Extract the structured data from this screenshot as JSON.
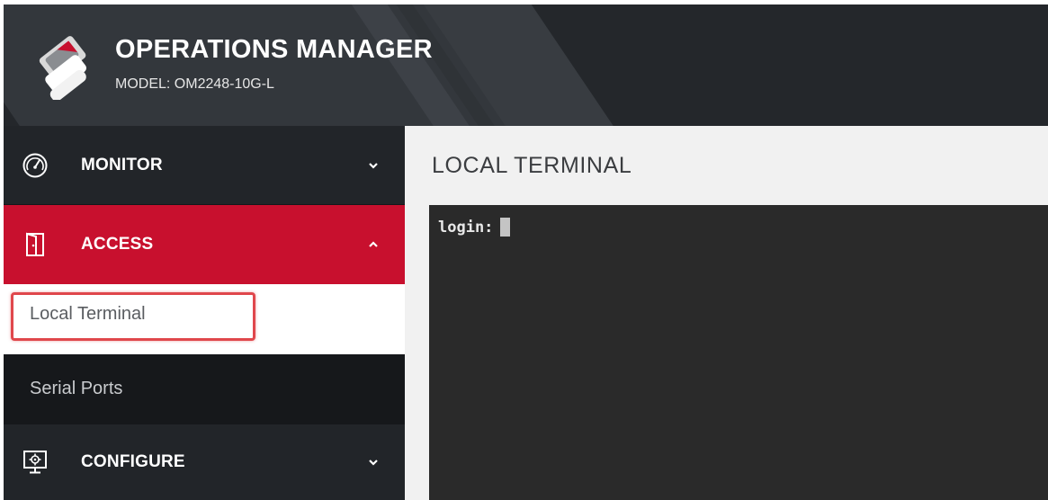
{
  "header": {
    "title": "OPERATIONS MANAGER",
    "model": "MODEL: OM2248-10G-L",
    "logo_icon": "opengear-logo-icon"
  },
  "sidebar": {
    "items": [
      {
        "label": "MONITOR",
        "icon": "speedometer-icon",
        "chevron": "chevron-down-icon",
        "expanded": false
      },
      {
        "label": "ACCESS",
        "icon": "door-icon",
        "chevron": "chevron-up-icon",
        "expanded": true,
        "children": [
          {
            "label": "Local Terminal",
            "selected": true
          },
          {
            "label": "Serial Ports",
            "selected": false
          }
        ]
      },
      {
        "label": "CONFIGURE",
        "icon": "gear-monitor-icon",
        "chevron": "chevron-down-icon",
        "expanded": false
      }
    ]
  },
  "main": {
    "title": "LOCAL TERMINAL",
    "terminal": {
      "prompt": "login:"
    }
  },
  "colors": {
    "accent": "#c8102e",
    "highlight": "#e0474c",
    "header_bg": "#24272b",
    "sidebar_bg": "#1a1c1f",
    "terminal_bg": "#2a2a2a"
  }
}
